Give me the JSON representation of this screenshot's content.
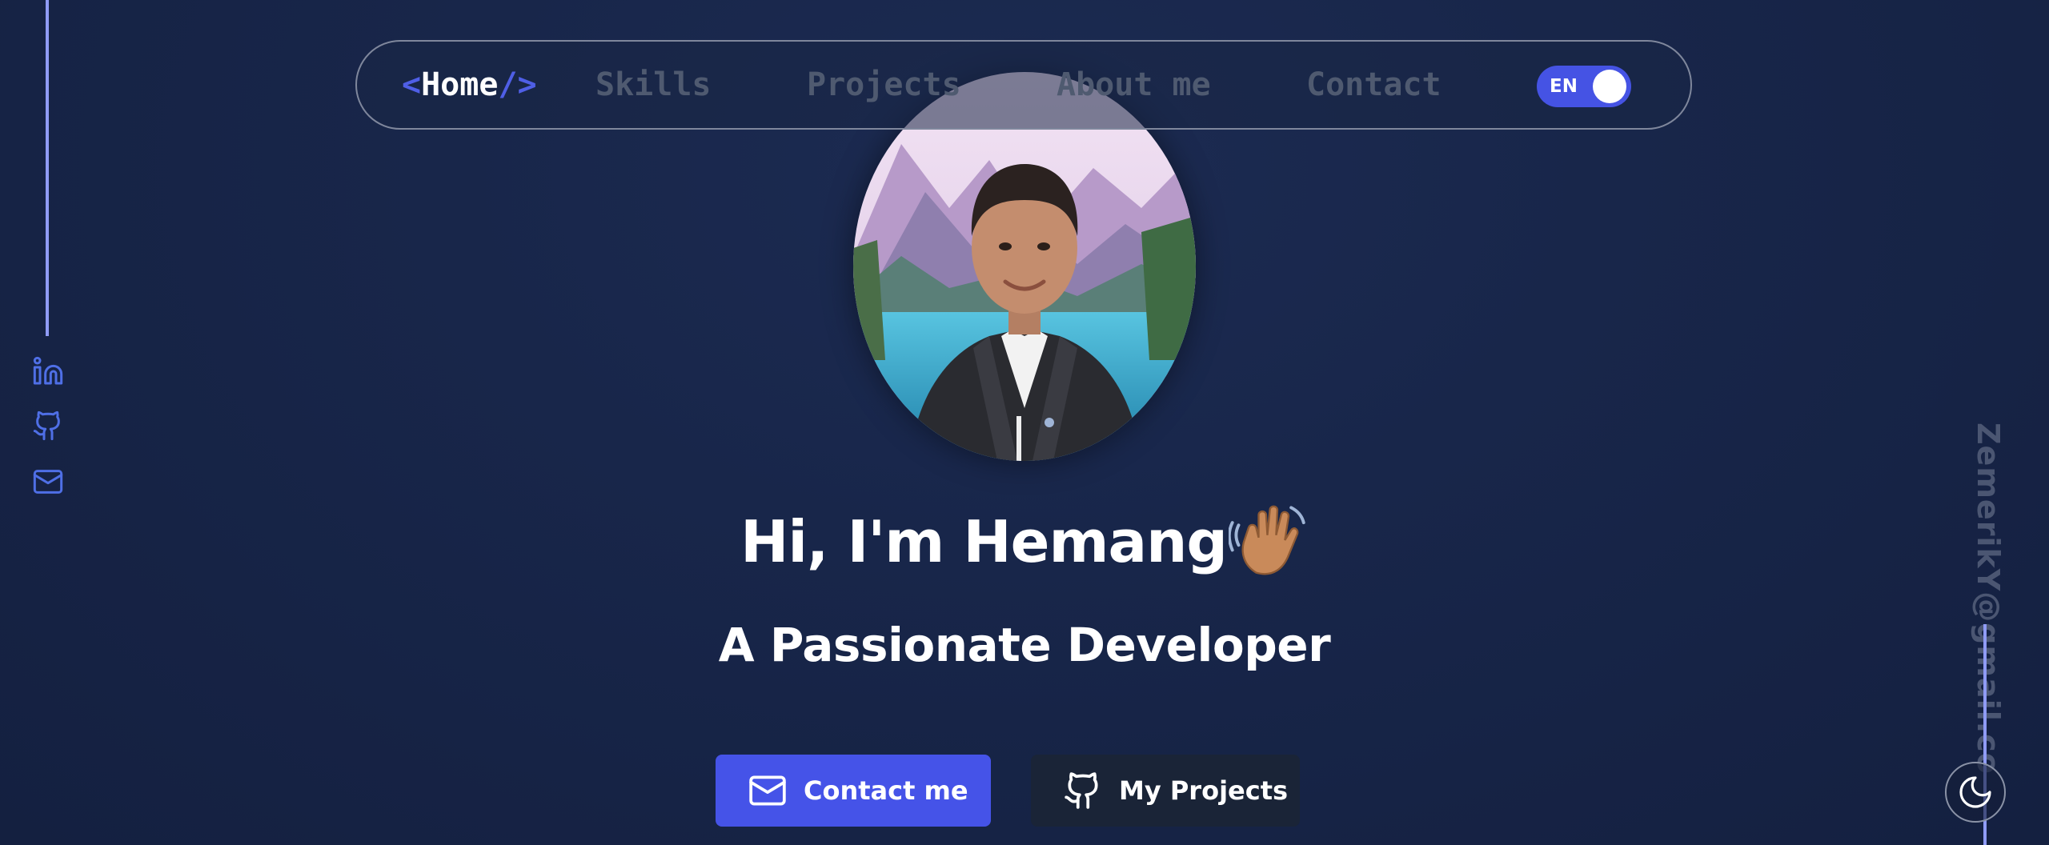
{
  "nav": {
    "home": {
      "open": "<",
      "label": "Home",
      "close": "/>"
    },
    "items": [
      {
        "label": "Skills"
      },
      {
        "label": "Projects"
      },
      {
        "label": "About me"
      },
      {
        "label": "Contact"
      }
    ],
    "language": {
      "label": "EN"
    }
  },
  "social": [
    {
      "icon": "linkedin-icon"
    },
    {
      "icon": "github-icon"
    },
    {
      "icon": "mail-icon"
    }
  ],
  "hero": {
    "greeting": "Hi, I'm Hemang",
    "emoji": "waving-hand",
    "tagline": "A Passionate Developer"
  },
  "buttons": {
    "contact": {
      "label": "Contact me",
      "icon": "mail-icon"
    },
    "projects": {
      "label": "My Projects",
      "icon": "github-icon"
    }
  },
  "sidebar_right": {
    "email": "ZemerikY@gmail.com"
  },
  "theme_toggle": {
    "icon": "moon-icon"
  },
  "colors": {
    "accent": "#4553e8",
    "background": "#18264a",
    "line": "#8f9bf5",
    "nav_inactive": "#4f5a70",
    "secondary_button": "#1a2437"
  }
}
